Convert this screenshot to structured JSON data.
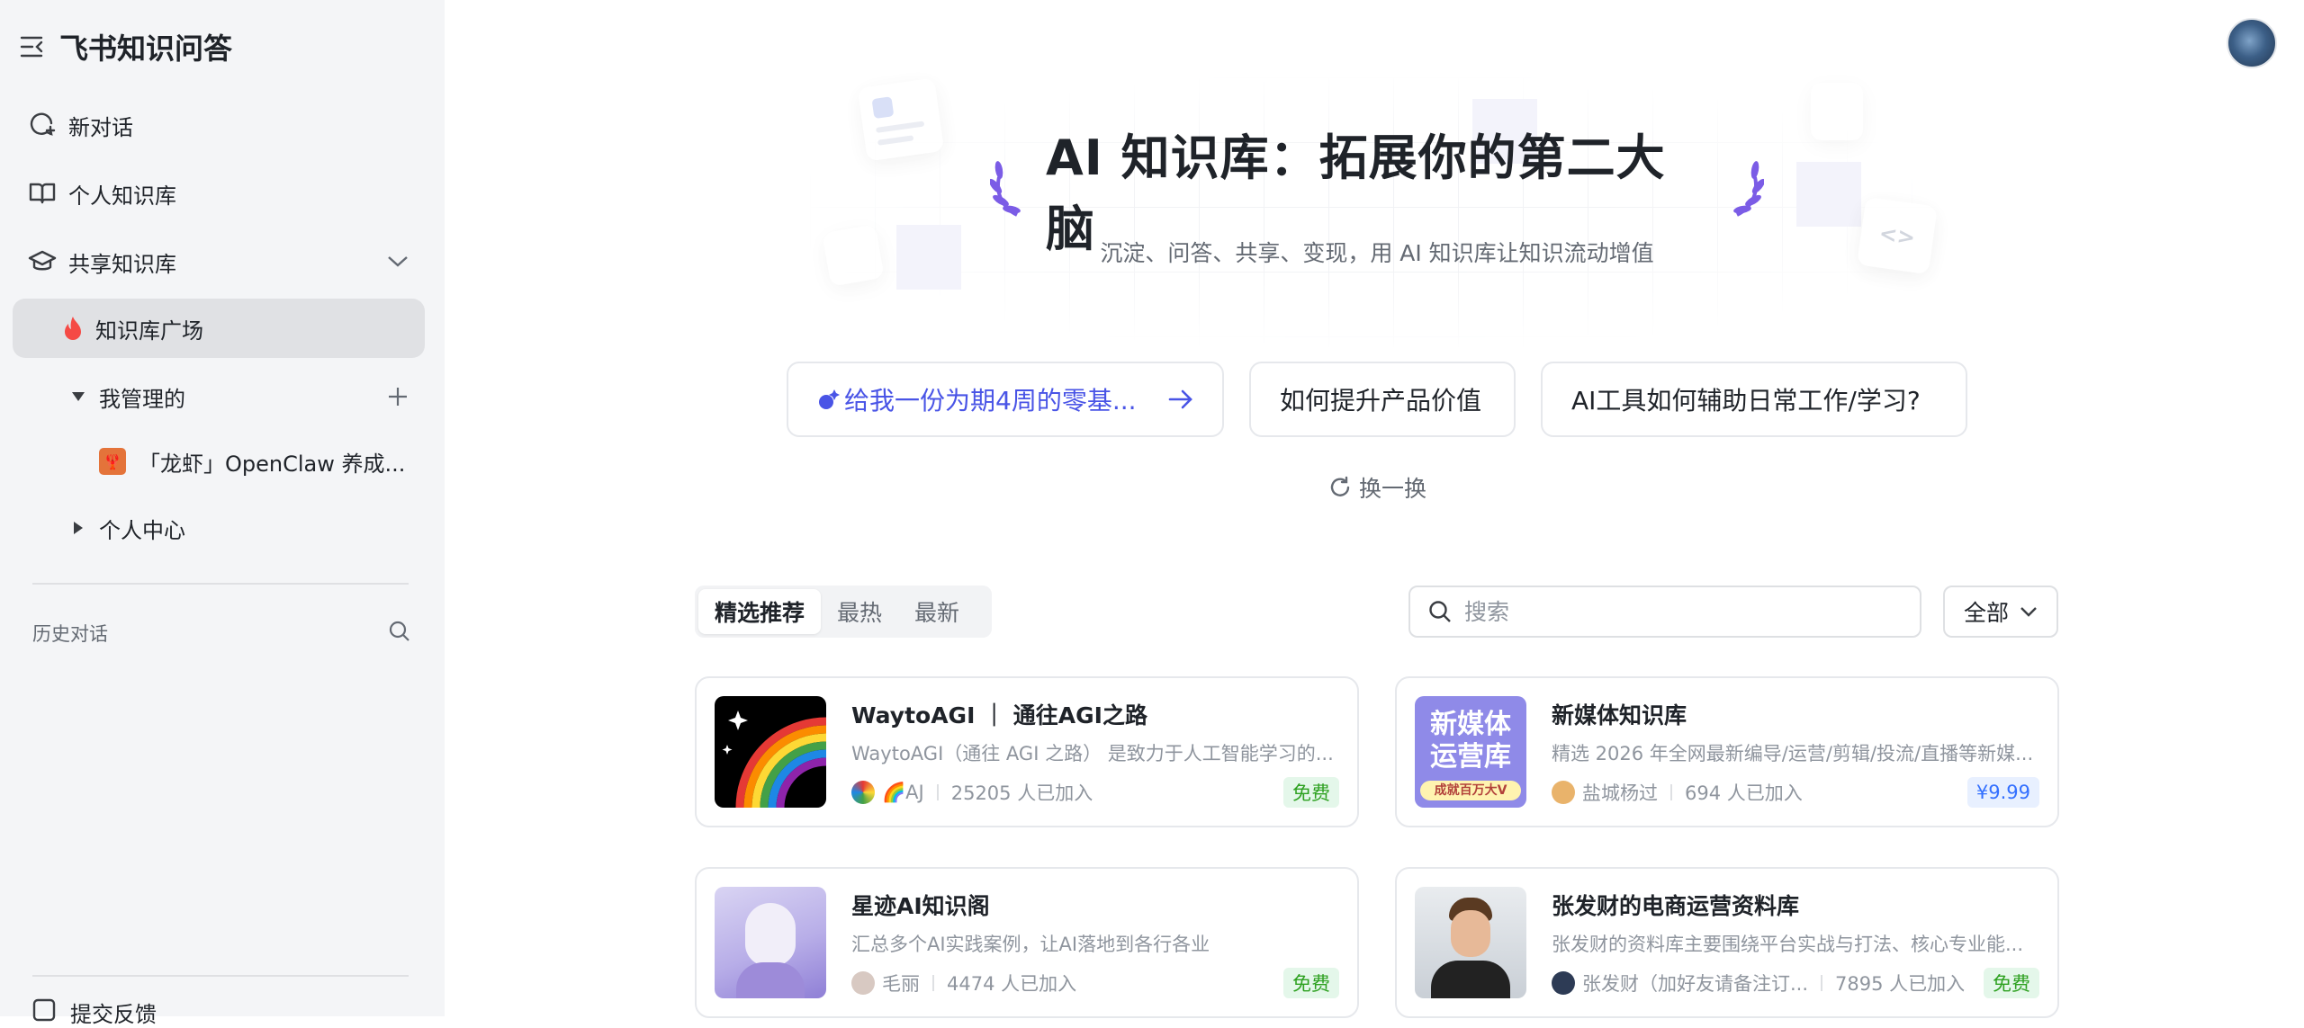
{
  "sidebar": {
    "app_title": "飞书知识问答",
    "new_chat": "新对话",
    "personal_kb": "个人知识库",
    "shared_kb": "共享知识库",
    "kb_plaza": "知识库广场",
    "managed": "我管理的",
    "managed_kb_item": "「龙虾」OpenClaw 养成...",
    "personal_center": "个人中心",
    "history": "历史对话",
    "feedback": "提交反馈"
  },
  "hero": {
    "title": "AI 知识库：拓展你的第二大脑",
    "subtitle": "沉淀、问答、共享、变现，用 AI 知识库让知识流动增值"
  },
  "suggestions": [
    {
      "label": "给我一份为期4周的零基..."
    },
    {
      "label": "如何提升产品价值"
    },
    {
      "label": "AI工具如何辅助日常工作/学习?"
    }
  ],
  "refresh_label": "换一换",
  "tabs": [
    "精选推荐",
    "最热",
    "最新"
  ],
  "search": {
    "placeholder": "搜索"
  },
  "filter": {
    "selected": "全部"
  },
  "cards": [
    {
      "title": "WaytoAGI ｜ 通往AGI之路",
      "desc": "WaytoAGI（通往 AGI 之路） 是致力于人工智能学习的...",
      "author": "🌈AJ",
      "joined": "25205 人已加入",
      "badge": "免费"
    },
    {
      "title": "新媒体知识库",
      "desc": "精选 2026 年全网最新编导/运营/剪辑/投流/直播等新媒...",
      "author": "盐城杨过",
      "joined": "694 人已加入",
      "badge": "¥9.99",
      "thumb_line1": "新媒体",
      "thumb_line2": "运营库",
      "thumb_tag": "成就百万大V"
    },
    {
      "title": "星迹AI知识阁",
      "desc": "汇总多个AI实践案例，让AI落地到各行各业",
      "author": "毛丽",
      "joined": "4474 人已加入",
      "badge": "免费"
    },
    {
      "title": "张发财的电商运营资料库",
      "desc": "张发财的资料库主要围绕平台实战与打法、核心专业能...",
      "author": "张发财（加好友请备注订...",
      "joined": "7895 人已加入",
      "badge": "免费"
    }
  ],
  "colors": {
    "accent": "#4954e6",
    "laurel": "#7b5ce6",
    "free": "#2ea121",
    "price": "#3370ff"
  }
}
